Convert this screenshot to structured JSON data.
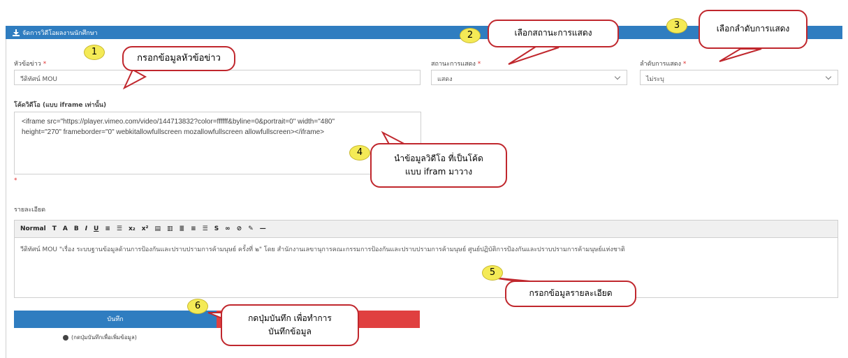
{
  "header": {
    "title": "จัดการวิดีโอผลงานนักศึกษา"
  },
  "fields": {
    "headline": {
      "label": "หัวข้อข่าว",
      "value": "วีดิทัศน์ MOU"
    },
    "status": {
      "label": "สถานะการแสดง",
      "value": "แสดง"
    },
    "order": {
      "label": "ลำดับการแสดง",
      "value": "ไม่ระบุ"
    },
    "video": {
      "label": "โค้ดวิดีโอ (แบบ iframe เท่านั้น)",
      "value": "<iframe src=\"https://player.vimeo.com/video/144713832?color=ffffff&byline=0&portrait=0\" width=\"480\"\nheight=\"270\" frameborder=\"0\" webkitallowfullscreen mozallowfullscreen allowfullscreen></iframe>"
    },
    "detail": {
      "label": "รายละเอียด",
      "format_value": "Normal",
      "body": "วีดิทัศน์ MOU \"เรื่อง ระบบฐานข้อมูลด้านการป้องกันและปราบปรามการค้ามนุษย์ ครั้งที่ ๒\" โดย สำนักงานเลขานุการคณะกรรมการป้องกันและปราบปรามการค้ามนุษย์ ศูนย์ปฏิบัติการป้องกันและปราบปรามการค้ามนุษย์แห่งชาติ"
    },
    "required_mark": "*"
  },
  "toolbar": {
    "items": [
      "T",
      "A",
      "B",
      "I",
      "U",
      "≡",
      "☰",
      "x₂",
      "x²",
      "▤",
      "▥",
      "≣",
      "≡",
      "☰",
      "S",
      "∞",
      "⊘",
      "✎",
      "—"
    ]
  },
  "actions": {
    "save_label": "บันทึก",
    "note": "(กดปุ่มบันทึกเพื่อเพิ่มข้อมูล)"
  },
  "callouts": {
    "c1": {
      "badge": "1",
      "text": "กรอกข้อมูลหัวข้อข่าว"
    },
    "c2": {
      "badge": "2",
      "text": "เลือกสถานะการแสดง"
    },
    "c3": {
      "badge": "3",
      "text": "เลือกลำดับการแสดง"
    },
    "c4": {
      "badge": "4",
      "line1": "นำข้อมูลวิดีโอ ที่เป็นโค้ด",
      "line2": "แบบ ifram มาวาง"
    },
    "c5": {
      "badge": "5",
      "text": "กรอกข้อมูลรายละเอียด"
    },
    "c6": {
      "badge": "6",
      "line1": "กดปุ่มบันทึก เพื่อทำการ",
      "line2": "บันทึกข้อมูล"
    }
  }
}
